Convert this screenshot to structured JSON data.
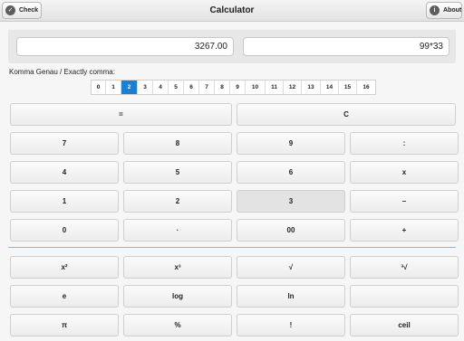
{
  "header": {
    "title": "Calculator",
    "check_label": "Check",
    "about_label": "About",
    "about_icon": "i"
  },
  "display": {
    "result": "3267.00",
    "expression": "99*33"
  },
  "comma": {
    "label": "Komma Genau / Exactly comma:",
    "options": [
      "0",
      "1",
      "2",
      "3",
      "4",
      "5",
      "6",
      "7",
      "8",
      "9",
      "10",
      "11",
      "12",
      "13",
      "14",
      "15",
      "16"
    ],
    "selected": "2"
  },
  "keypad": {
    "row1": [
      "=",
      "C"
    ],
    "row2": [
      "7",
      "8",
      "9",
      ":"
    ],
    "row3": [
      "4",
      "5",
      "6",
      "x"
    ],
    "row4": [
      "1",
      "2",
      "3",
      "–"
    ],
    "row5": [
      "0",
      "·",
      "00",
      "+"
    ],
    "row6": [
      "x²",
      "x³",
      "√",
      "³√"
    ],
    "row7": [
      "e",
      "log",
      "ln",
      ""
    ],
    "row8": [
      "π",
      "%",
      "!",
      "ceil"
    ]
  },
  "colors": {
    "accent": "#1f7fcf",
    "separator": "#8fb6d8"
  }
}
